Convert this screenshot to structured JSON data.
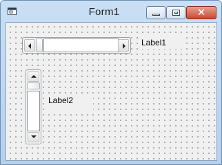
{
  "window": {
    "title": "Form1",
    "icon": "form-window-icon",
    "buttons": {
      "minimize_icon": "minimize-icon",
      "maximize_icon": "maximize-icon",
      "close_glyph": "✕"
    }
  },
  "form": {
    "label1": "Label1",
    "label2": "Label2",
    "hscrollbar": {
      "left_arrow_icon": "arrow-left-icon",
      "right_arrow_icon": "arrow-right-icon"
    },
    "vscrollbar": {
      "up_arrow_icon": "arrow-up-icon",
      "down_arrow_icon": "arrow-down-icon"
    }
  },
  "colors": {
    "titlebar": "#c9dff5",
    "close_button": "#c94a33",
    "client_background": "#f0f0f0"
  }
}
